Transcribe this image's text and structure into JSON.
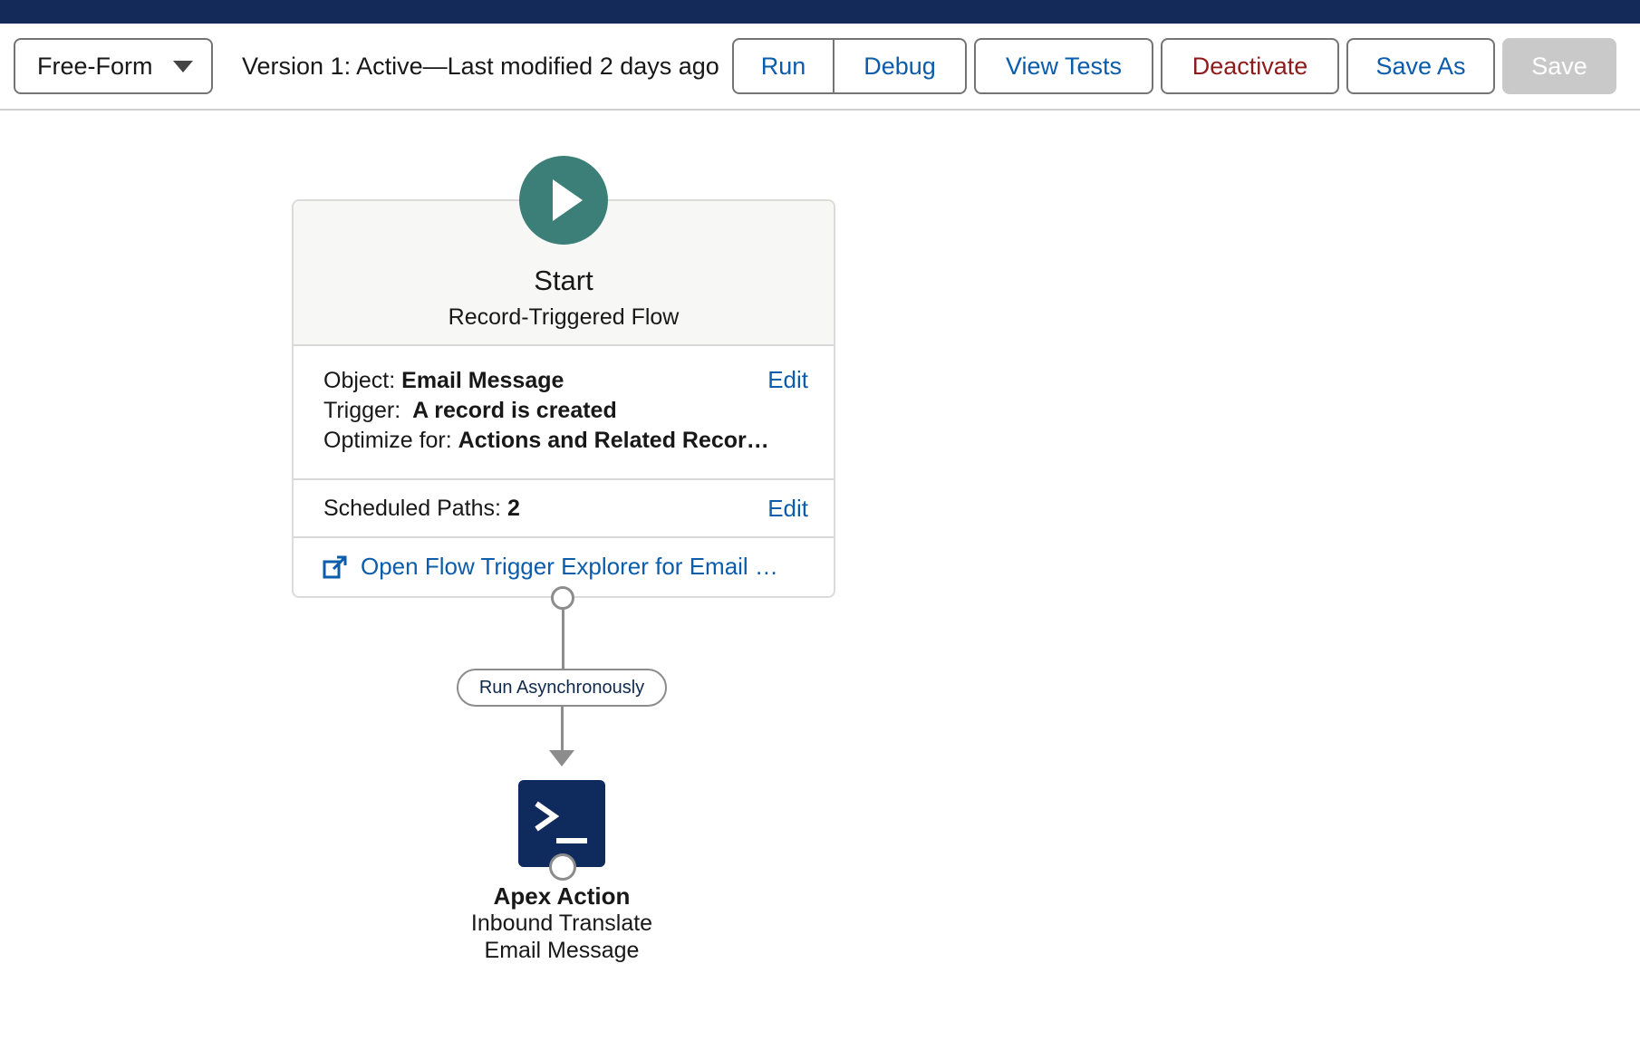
{
  "toolbar": {
    "layout_select": "Free-Form",
    "version_text": "Version 1: Active—Last modified 2 days ago",
    "run": "Run",
    "debug": "Debug",
    "view_tests": "View Tests",
    "deactivate": "Deactivate",
    "save_as": "Save As",
    "save": "Save"
  },
  "start_node": {
    "title": "Start",
    "subtitle": "Record-Triggered Flow",
    "object_label": "Object:",
    "object_value": "Email Message",
    "trigger_label": "Trigger:",
    "trigger_value": "A record is created",
    "optimize_label": "Optimize for:",
    "optimize_value": "Actions and Related Recor…",
    "edit": "Edit",
    "scheduled_label": "Scheduled Paths:",
    "scheduled_value": "2",
    "scheduled_edit": "Edit",
    "explorer_link": "Open Flow Trigger Explorer for Email …"
  },
  "connector": {
    "label": "Run Asynchronously"
  },
  "apex_node": {
    "title": "Apex Action",
    "line1": "Inbound Translate",
    "line2": "Email Message"
  },
  "colors": {
    "header_bar": "#142b5a",
    "link": "#0b5cab",
    "deactivate": "#8e1b1b",
    "start_icon": "#3b7f78",
    "apex_icon": "#0f2a5c"
  },
  "icons": [
    "play-icon",
    "external-link-icon",
    "apex-terminal-icon",
    "chevron-down-icon"
  ]
}
